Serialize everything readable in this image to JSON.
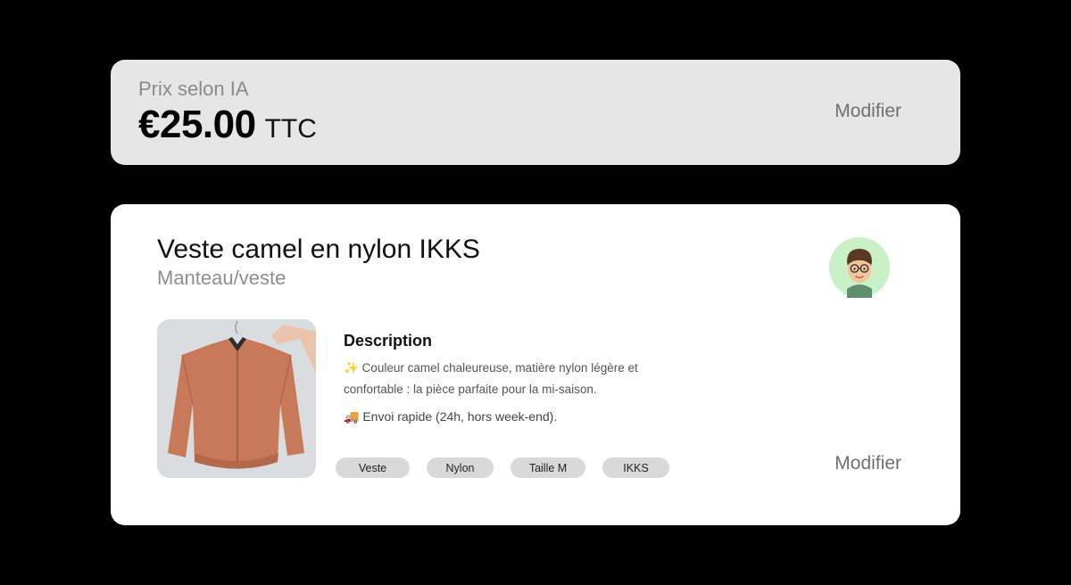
{
  "price_card": {
    "label": "Prix selon IA",
    "value": "€25.00",
    "suffix": "TTC",
    "modify_label": "Modifier"
  },
  "product": {
    "title": "Veste camel en nylon IKKS",
    "category": "Manteau/veste",
    "description_title": "Description",
    "description_line1": "✨ Couleur camel chaleureuse, matière nylon légère et confortable : la pièce parfaite pour la mi-saison.",
    "description_line2": "🚚 Envoi rapide (24h, hors week-end).",
    "tags": [
      "Veste",
      "Nylon",
      "Taille M",
      "IKKS"
    ],
    "modify_label": "Modifier",
    "avatar_icon": "user-avatar-icon",
    "jacket_color": "#c7795a",
    "avatar_bg": "#c9f0c6"
  }
}
